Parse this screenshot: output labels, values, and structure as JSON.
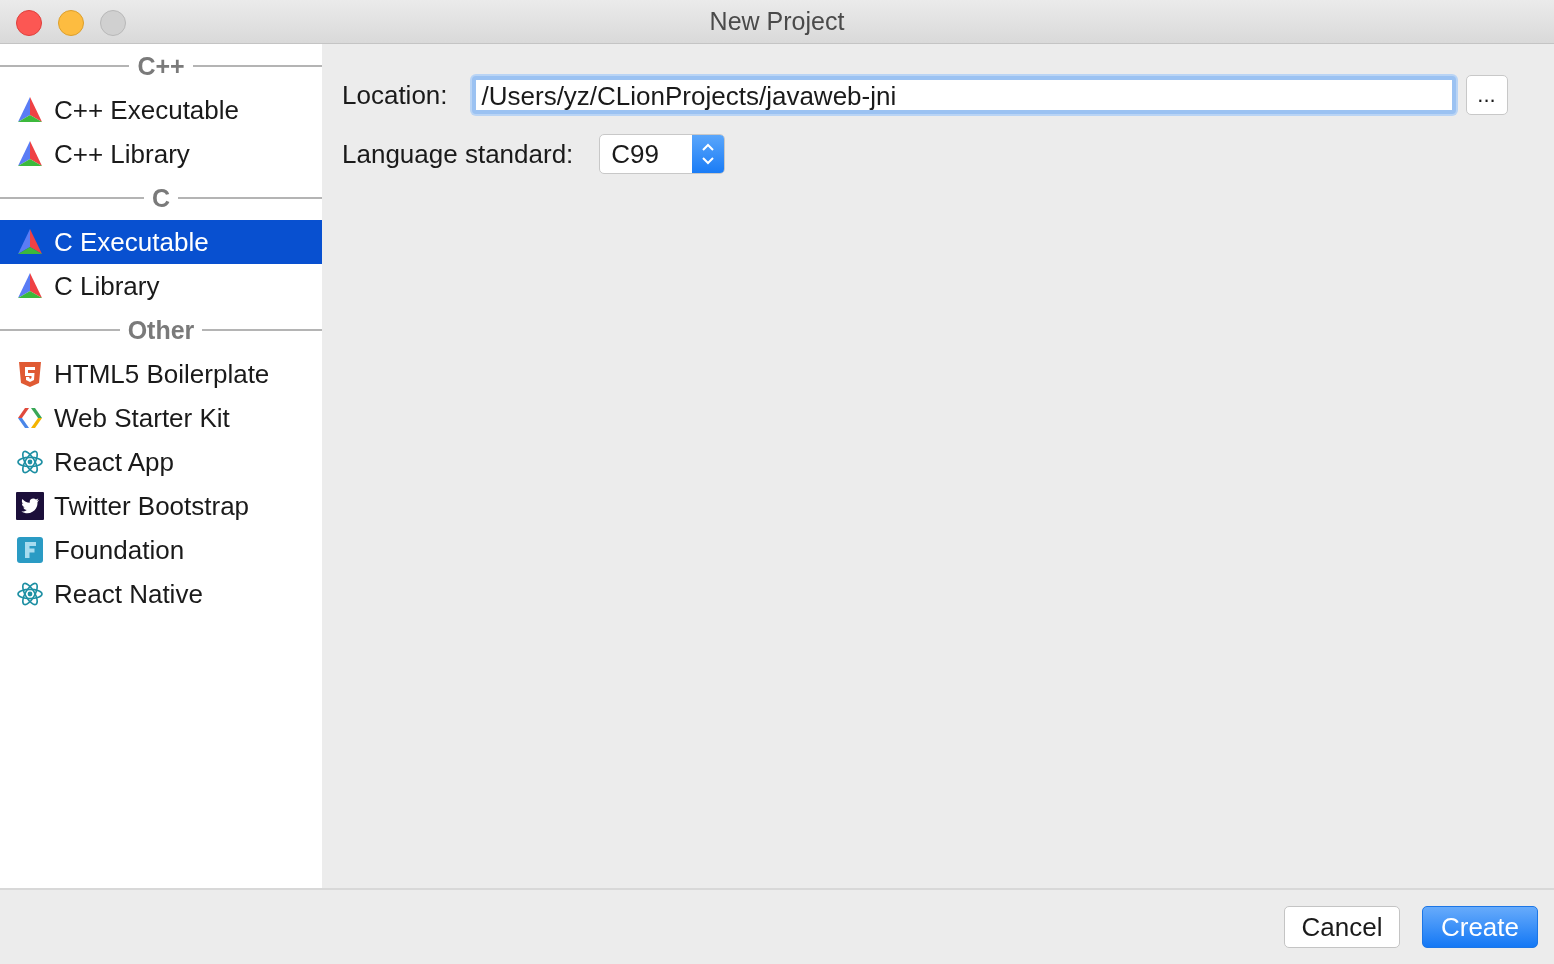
{
  "window": {
    "title": "New Project"
  },
  "sidebar": {
    "groups": [
      {
        "heading": "C++",
        "items": [
          {
            "label": "C++ Executable",
            "kind": "clion",
            "selected": false
          },
          {
            "label": "C++ Library",
            "kind": "clion",
            "selected": false
          }
        ]
      },
      {
        "heading": "C",
        "items": [
          {
            "label": "C Executable",
            "kind": "clion",
            "selected": true
          },
          {
            "label": "C Library",
            "kind": "clion",
            "selected": false
          }
        ]
      },
      {
        "heading": "Other",
        "items": [
          {
            "label": "HTML5 Boilerplate",
            "kind": "html5",
            "selected": false
          },
          {
            "label": "Web Starter Kit",
            "kind": "webstarter",
            "selected": false
          },
          {
            "label": "React App",
            "kind": "react",
            "selected": false
          },
          {
            "label": "Twitter Bootstrap",
            "kind": "twitter",
            "selected": false
          },
          {
            "label": "Foundation",
            "kind": "foundation",
            "selected": false
          },
          {
            "label": "React Native",
            "kind": "react",
            "selected": false
          }
        ]
      }
    ]
  },
  "form": {
    "location": {
      "label": "Location:",
      "value": "/Users/yz/CLionProjects/javaweb-jni",
      "browse": "..."
    },
    "language_standard": {
      "label": "Language standard:",
      "value": "C99"
    }
  },
  "buttons": [
    {
      "label": "Cancel",
      "kind": "secondary"
    },
    {
      "label": "Create",
      "kind": "primary"
    }
  ]
}
